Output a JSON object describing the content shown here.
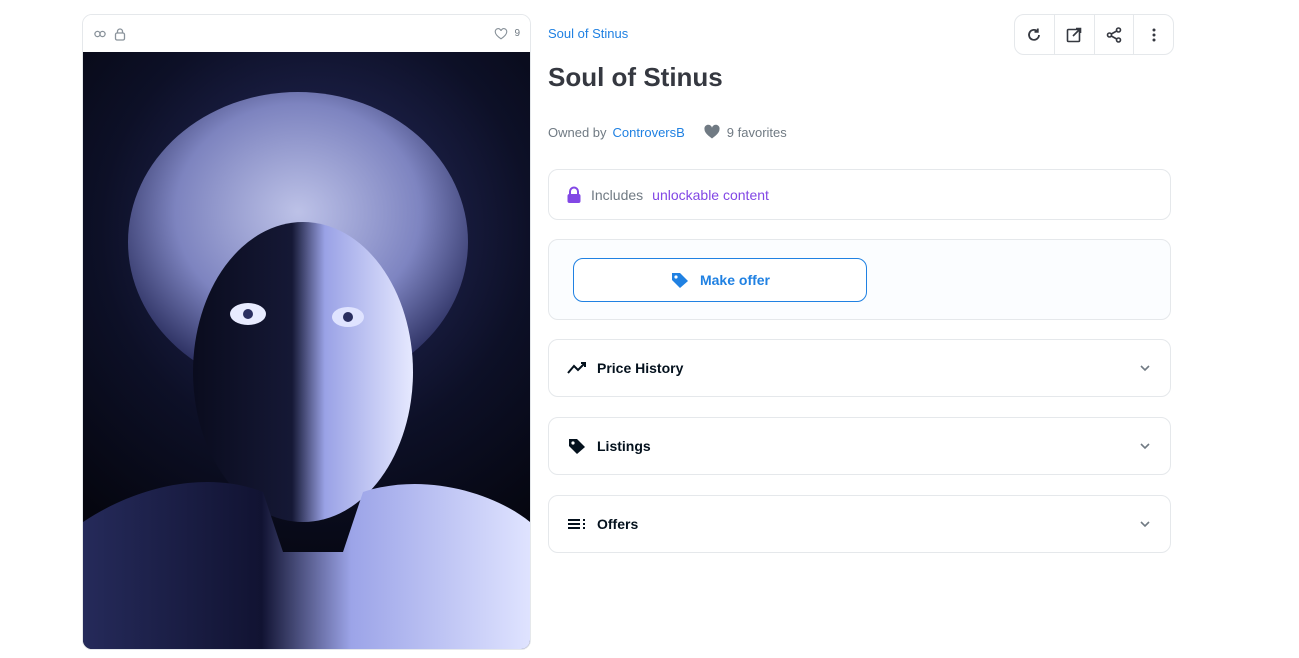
{
  "art": {
    "favorites_count": "9"
  },
  "collection": {
    "name": "Soul of Stinus"
  },
  "item": {
    "title": "Soul of Stinus",
    "owned_by_label": "Owned by",
    "owner": "ControversB",
    "favorites": "9 favorites"
  },
  "unlockable": {
    "prefix": "Includes",
    "accent": "unlockable content"
  },
  "offer": {
    "make_offer_label": "Make offer"
  },
  "sections": {
    "price_history": "Price History",
    "listings": "Listings",
    "offers": "Offers"
  },
  "colors": {
    "accent_blue": "#2081e2",
    "unlock_purple": "#8247e5",
    "border": "#e5e8eb"
  }
}
